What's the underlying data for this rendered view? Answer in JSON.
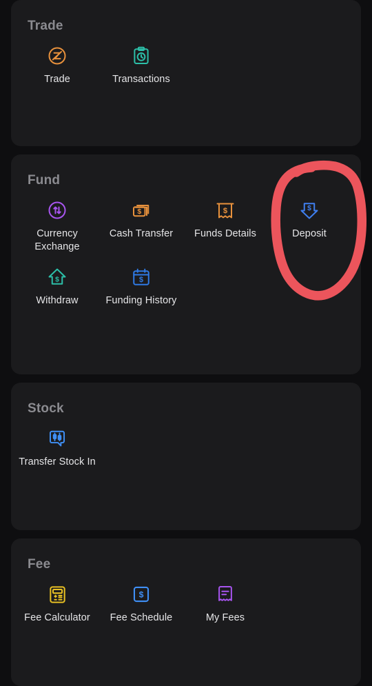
{
  "theme": {
    "page_bg": "#0e0e10",
    "card_bg": "#1b1b1d",
    "section_title_color": "#8b8b90",
    "label_color": "#e6e6e8",
    "annotation_color": "#f4585e"
  },
  "sections": [
    {
      "title": "Trade",
      "items": [
        {
          "label": "Trade",
          "icon": "trade-circle-z-icon",
          "color": "#e8913c"
        },
        {
          "label": "Transactions",
          "icon": "clipboard-clock-icon",
          "color": "#2cbfa8"
        }
      ]
    },
    {
      "title": "Fund",
      "items": [
        {
          "label": "Currency Exchange",
          "icon": "currency-exchange-arrows-icon",
          "color": "#a855f0"
        },
        {
          "label": "Cash Transfer",
          "icon": "stacked-cash-cards-icon",
          "color": "#e8913c"
        },
        {
          "label": "Funds Details",
          "icon": "receipt-dollar-icon",
          "color": "#e8913c"
        },
        {
          "label": "Deposit",
          "icon": "down-arrow-dollar-icon",
          "color": "#3f7ff0"
        },
        {
          "label": "Withdraw",
          "icon": "up-arrow-dollar-icon",
          "color": "#2cbfa8"
        },
        {
          "label": "Funding History",
          "icon": "calendar-dollar-icon",
          "color": "#2f7ae5"
        }
      ]
    },
    {
      "title": "Stock",
      "items": [
        {
          "label": "Transfer Stock In",
          "icon": "chat-candlestick-icon",
          "color": "#3f8ff5"
        }
      ]
    },
    {
      "title": "Fee",
      "items": [
        {
          "label": "Fee Calculator",
          "icon": "calculator-icon",
          "color": "#e8c023"
        },
        {
          "label": "Fee Schedule",
          "icon": "square-dollar-icon",
          "color": "#3f8ff5"
        },
        {
          "label": "My Fees",
          "icon": "receipt-lines-icon",
          "color": "#a855f0"
        }
      ]
    }
  ],
  "annotation": {
    "kind": "hand-drawn-red-ellipse",
    "target_label": "Deposit"
  }
}
